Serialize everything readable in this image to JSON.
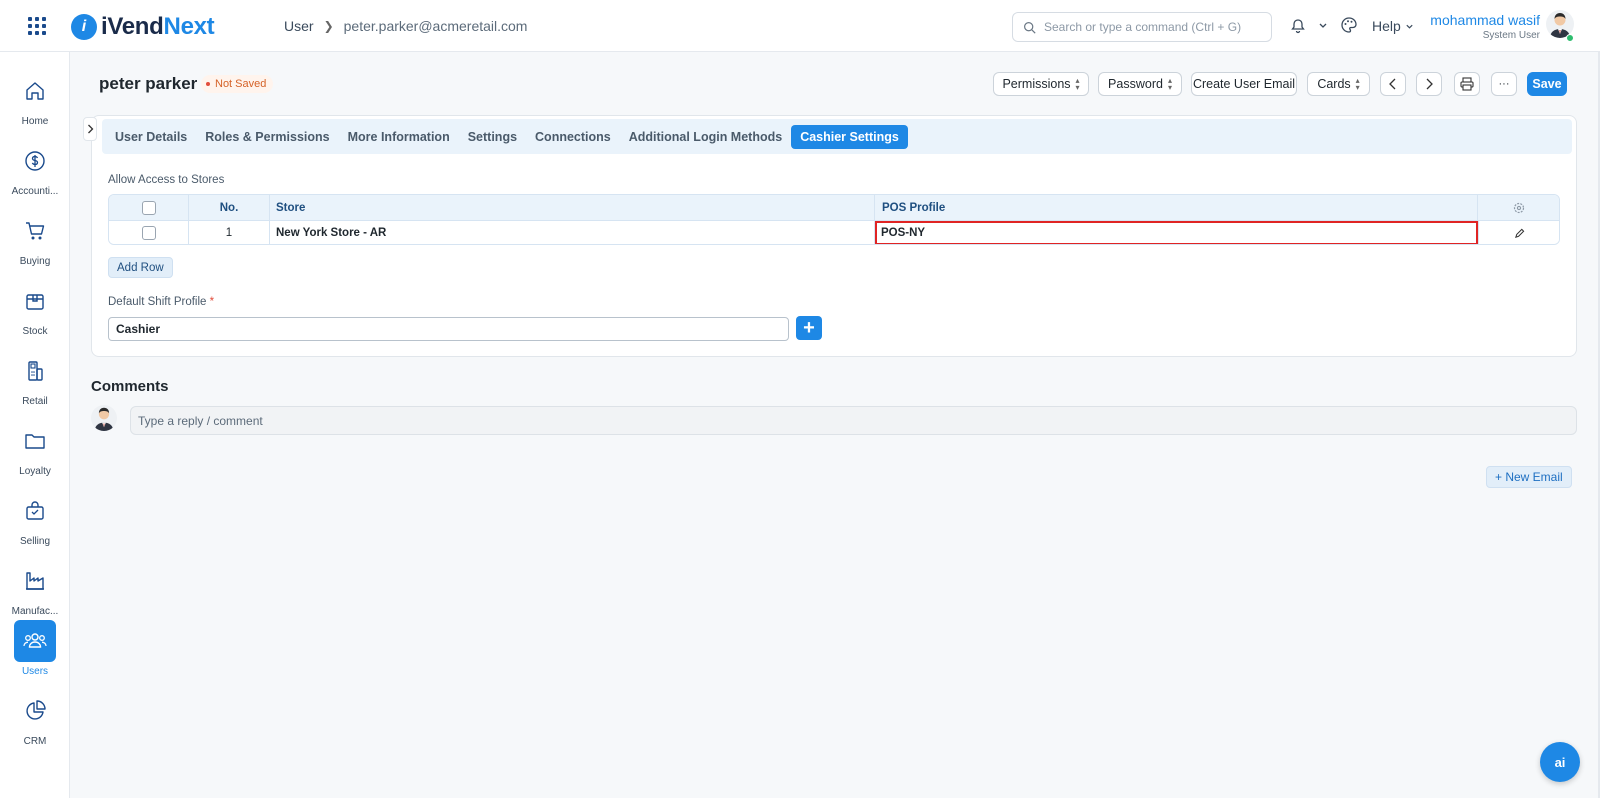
{
  "header": {
    "logo_prefix": "iVend",
    "logo_accent": "Next",
    "logo_badge": "i",
    "breadcrumb": [
      "User",
      "peter.parker@acmeretail.com"
    ],
    "search_placeholder": "Search or type a command (Ctrl + G)",
    "help_label": "Help",
    "user_name": "mohammad wasif",
    "user_role": "System User"
  },
  "sidebar": {
    "items": [
      {
        "label": "Home",
        "icon": "home-icon"
      },
      {
        "label": "Accounti...",
        "icon": "dollar-icon"
      },
      {
        "label": "Buying",
        "icon": "cart-icon"
      },
      {
        "label": "Stock",
        "icon": "box-icon"
      },
      {
        "label": "Retail",
        "icon": "pos-terminal-icon"
      },
      {
        "label": "Loyalty",
        "icon": "folder-icon"
      },
      {
        "label": "Selling",
        "icon": "shopping-bag-icon"
      },
      {
        "label": "Manufac...",
        "icon": "factory-icon"
      },
      {
        "label": "Users",
        "icon": "users-icon",
        "active": true
      },
      {
        "label": "CRM",
        "icon": "pie-chart-icon"
      }
    ]
  },
  "page": {
    "title": "peter parker",
    "status": "Not Saved",
    "actions": {
      "permissions": "Permissions",
      "password": "Password",
      "create_user_email": "Create User Email",
      "cards": "Cards",
      "more": "···",
      "save": "Save"
    }
  },
  "tabs": [
    {
      "label": "User Details"
    },
    {
      "label": "Roles & Permissions"
    },
    {
      "label": "More Information"
    },
    {
      "label": "Settings"
    },
    {
      "label": "Connections"
    },
    {
      "label": "Additional Login Methods"
    },
    {
      "label": "Cashier Settings",
      "active": true
    }
  ],
  "stores_section": {
    "label": "Allow Access to Stores",
    "columns": {
      "no": "No.",
      "store": "Store",
      "pos_profile": "POS Profile"
    },
    "rows": [
      {
        "no": "1",
        "store": "New York Store - AR",
        "pos_profile": "POS-NY"
      }
    ],
    "add_row_label": "Add Row"
  },
  "shift_profile": {
    "label": "Default Shift Profile",
    "required_mark": "*",
    "value": "Cashier",
    "add_label": "+"
  },
  "comments": {
    "title": "Comments",
    "placeholder": "Type a reply / comment"
  },
  "new_email_label": "+ New Email",
  "ai_label": "ai",
  "colors": {
    "primary": "#1e88e5",
    "status_text": "#d56227",
    "highlight_border": "#e02424"
  }
}
